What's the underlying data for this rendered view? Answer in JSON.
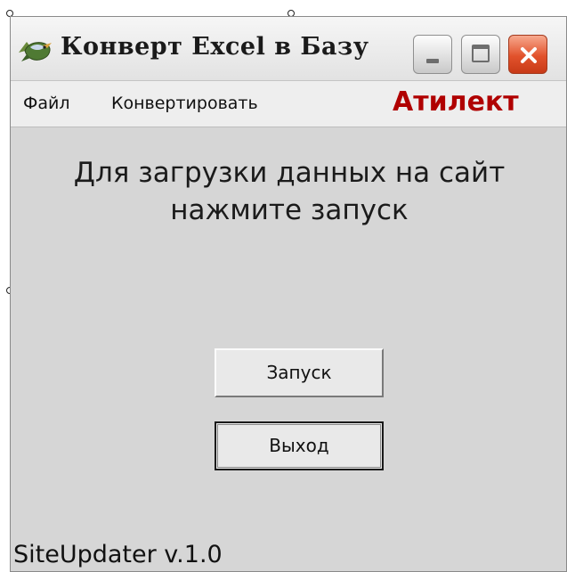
{
  "window": {
    "title": "Конверт Excel в Базу",
    "icon": "bird-app-icon"
  },
  "titlebar_buttons": {
    "minimize_icon": "minimize-icon",
    "maximize_icon": "maximize-icon",
    "close_icon": "close-icon",
    "close_color": "#e2522c"
  },
  "menu": {
    "items": [
      {
        "label": "Файл"
      },
      {
        "label": "Конвертировать"
      }
    ],
    "brand": "Атилект",
    "brand_color": "#b00000"
  },
  "content": {
    "instruction": "Для загрузки данных на сайт\nнажмите запуск",
    "start_button": "Запуск",
    "exit_button": "Выход",
    "version": "SiteUpdater v.1.0"
  }
}
